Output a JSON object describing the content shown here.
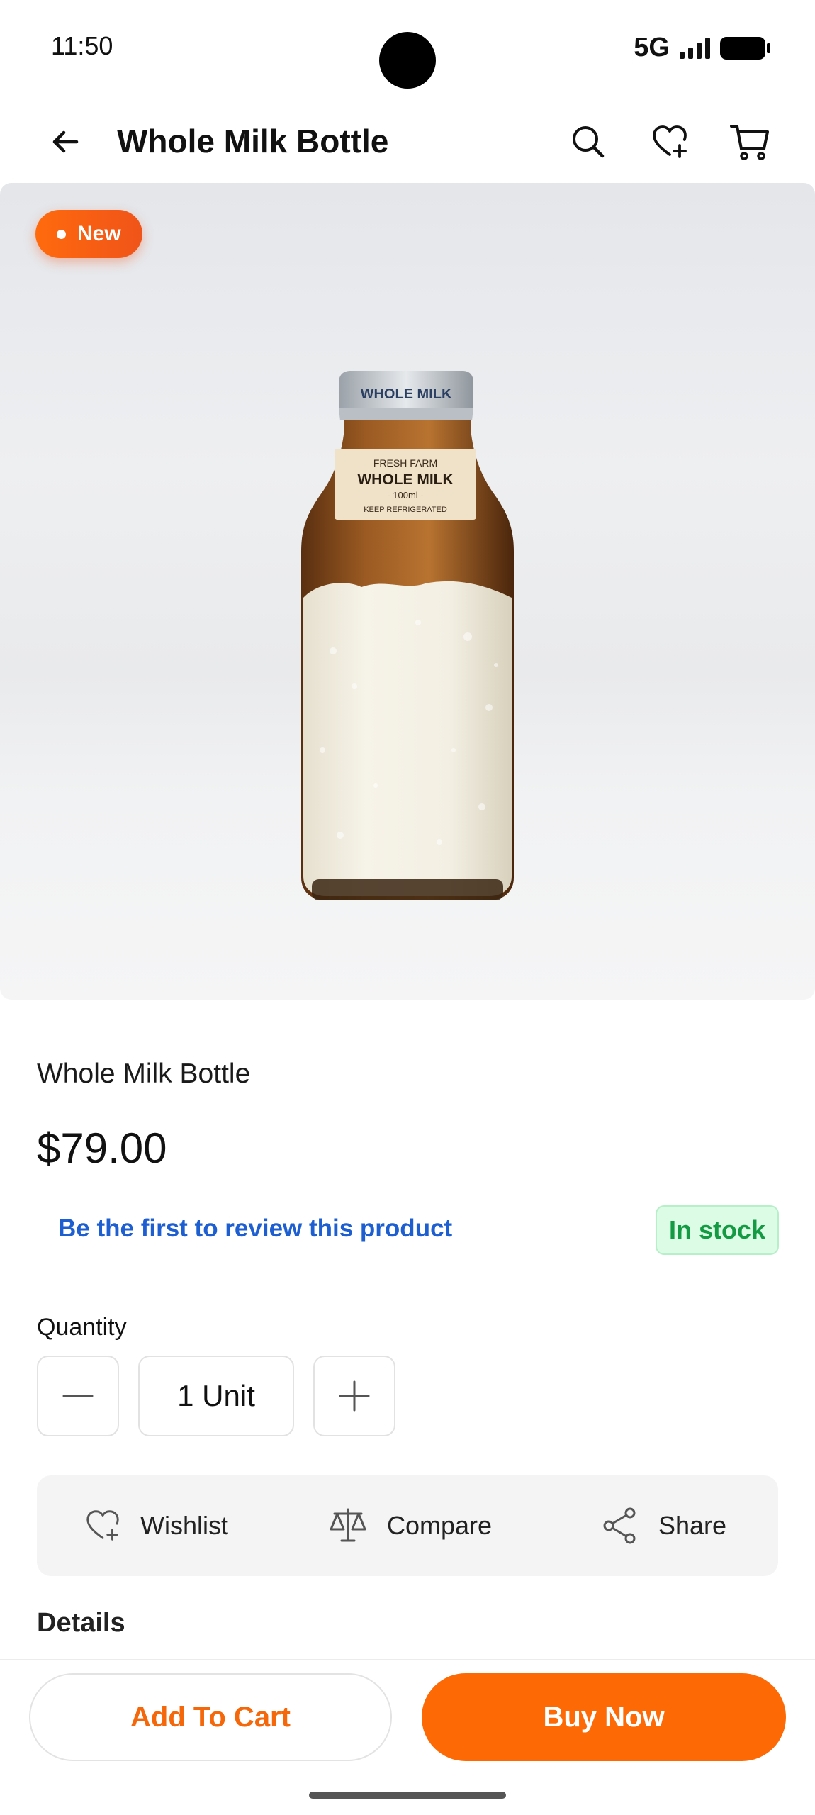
{
  "status_bar": {
    "time": "11:50",
    "network": "5G"
  },
  "app_bar": {
    "title": "Whole Milk Bottle",
    "icons": [
      "back-arrow-icon",
      "search-icon",
      "wishlist-add-icon",
      "cart-icon"
    ]
  },
  "image": {
    "badge": "New",
    "bottle_cap_text": "WHOLE MILK",
    "label_line1": "FRESH FARM",
    "label_line2": "WHOLE MILK",
    "label_line3": "- 100ml -",
    "label_line4": "KEEP REFRIGERATED"
  },
  "product": {
    "name": "Whole Milk Bottle",
    "price": "$79.00",
    "review_link": "Be the first to review this product",
    "stock_status": "In stock"
  },
  "quantity": {
    "label": "Quantity",
    "value": "1 Unit"
  },
  "actions": {
    "wishlist": "Wishlist",
    "compare": "Compare",
    "share": "Share"
  },
  "details_heading": "Details",
  "bottom_bar": {
    "add_to_cart": "Add To Cart",
    "buy_now": "Buy Now"
  },
  "colors": {
    "accent": "#FD6A05",
    "link": "#1D5FD1",
    "in_stock_text": "#139A43",
    "in_stock_bg": "#DCFCE5"
  }
}
